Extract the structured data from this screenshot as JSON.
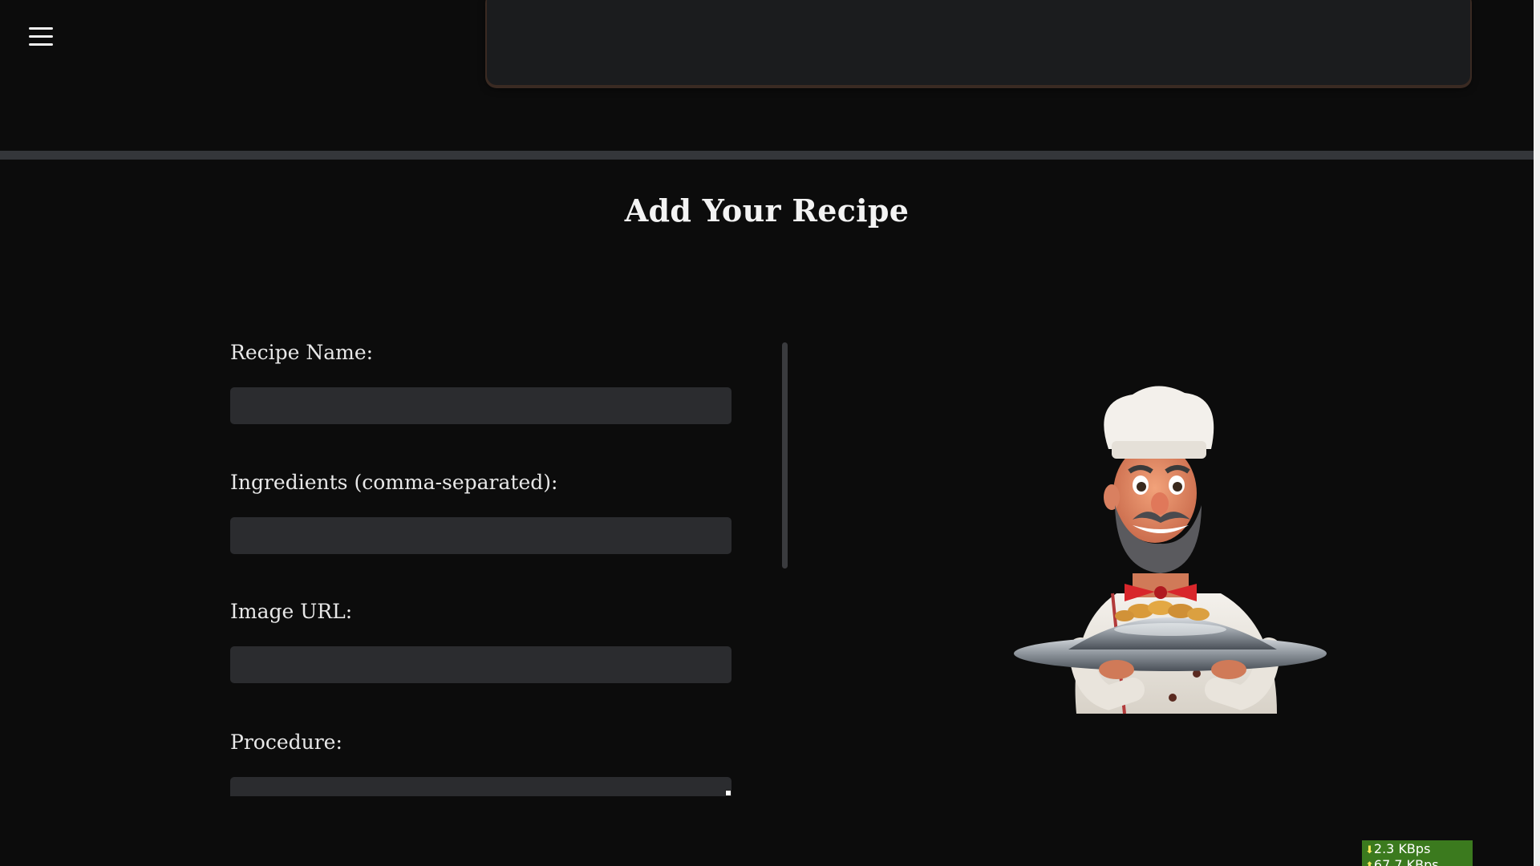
{
  "header": {
    "menu_icon": "hamburger-menu-icon"
  },
  "form": {
    "title": "Add Your Recipe",
    "recipe_name_label": "Recipe Name:",
    "recipe_name_value": "",
    "ingredients_label": "Ingredients (comma-separated):",
    "ingredients_value": "",
    "image_url_label": "Image URL:",
    "image_url_value": "",
    "procedure_label": "Procedure:"
  },
  "illustration": {
    "alt": "chef-illustration"
  },
  "network_meter": {
    "download_speed": "2.3 KBps",
    "upload_speed": "67.7 KBps"
  },
  "colors": {
    "background": "#0c0c0c",
    "input_background": "#2b2c2f",
    "divider": "#34363a",
    "badge_green": "#3b7a1e"
  }
}
